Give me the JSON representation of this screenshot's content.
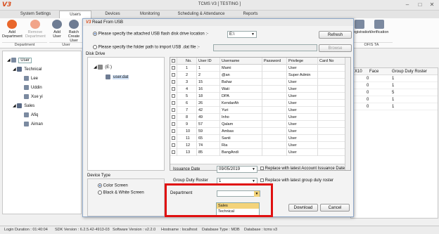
{
  "app": {
    "title": "TCMS V3 [ TESTING ]",
    "logo": "V3"
  },
  "tabs": [
    "System Settings",
    "Users",
    "Devices",
    "Monitoring",
    "Scheduling & Attendance",
    "Reports"
  ],
  "ribbon": {
    "buttons": [
      "Add Department",
      "Remove Department",
      "Add User",
      "Batch Create User"
    ],
    "right_buttons": [
      "Registration",
      "Verification"
    ],
    "groups": [
      "Department",
      "User",
      "OFIS TA"
    ]
  },
  "tree": {
    "root": "User",
    "departments": [
      {
        "name": "Technical",
        "users": [
          "Lee",
          "Uddin",
          "Xue yi"
        ]
      },
      {
        "name": "Sales",
        "users": [
          "Afiq",
          "Aiman"
        ]
      }
    ]
  },
  "bg_grid": {
    "headers": [
      "X10",
      "Face",
      "Group Duty Roster"
    ],
    "rows": [
      [
        "",
        "0",
        "1"
      ],
      [
        "",
        "0",
        "1"
      ],
      [
        "",
        "0",
        "5"
      ],
      [
        "",
        "0",
        "1"
      ],
      [
        "",
        "0",
        "1"
      ]
    ]
  },
  "dialog": {
    "title": "Read From USB",
    "opt_usb": "Please specify the attached USB flash disk drive location :-",
    "drive_value": "E:\\",
    "refresh": "Refresh",
    "opt_folder": "Please specify the folder path to import USB .dat file :-",
    "browse": "Browse",
    "disk_drive_label": "Disk Drive",
    "drive_node": "(E:)",
    "file_node": "user.dat",
    "grid_headers": [
      "No.",
      "User ID",
      "Username",
      "Password",
      "Privilege",
      "Card No"
    ],
    "grid_rows": [
      [
        "1",
        "1",
        "Mami",
        "",
        "User"
      ],
      [
        "2",
        "2",
        "@an",
        "",
        "Super Admin"
      ],
      [
        "3",
        "15",
        "Bahar",
        "",
        "User"
      ],
      [
        "4",
        "16",
        "Wati",
        "",
        "User"
      ],
      [
        "5",
        "18",
        "DPA",
        "",
        "User"
      ],
      [
        "6",
        "26",
        "KendarAh",
        "",
        "User"
      ],
      [
        "7",
        "42",
        "Yuri",
        "",
        "User"
      ],
      [
        "8",
        "49",
        "Inho",
        "",
        "User"
      ],
      [
        "9",
        "57",
        "Qalam",
        "",
        "User"
      ],
      [
        "10",
        "59",
        "Ambas",
        "",
        "User"
      ],
      [
        "11",
        "65",
        "Santi",
        "",
        "User"
      ],
      [
        "12",
        "74",
        "Ria",
        "",
        "User"
      ],
      [
        "13",
        "85",
        "BangAndi",
        "",
        "User"
      ]
    ],
    "issuance_label": "Issuance Date",
    "issuance_value": "09/05/2019",
    "replace_issuance": "Replace with latest Account Issuance Date",
    "duty_roster_label": "Group Duty Roster",
    "duty_roster_value": "1",
    "replace_roster": "Replace with latest group duty roster",
    "device_type_label": "Device Type",
    "color_screen": "Color Screen",
    "bw_screen": "Black & White Screen",
    "department_label": "Department",
    "department_options": [
      "Sales",
      "Technical"
    ],
    "download": "Download",
    "cancel": "Cancel"
  },
  "status": {
    "login": "Login Duration : 01:40:04",
    "sdk": "SDK Version : 6.2.5.42-4913-03",
    "software": "Software Version : v2.2.0",
    "hostname": "Hostname : localhost",
    "dbtype": "Database Type : MDB",
    "database": "Database : tcms v3"
  },
  "colors": {
    "highlight": "#e01010",
    "accent": "#2b5fb4",
    "logo": "#d84c1c"
  }
}
